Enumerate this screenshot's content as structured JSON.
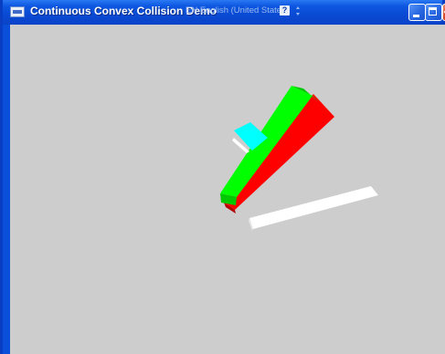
{
  "window": {
    "title": "Continuous Convex Collision Demo",
    "language_indicator": "EN English (United States)",
    "help_glyph": "?",
    "controls": [
      "minimize",
      "maximize",
      "close"
    ]
  },
  "viewport": {
    "background_color": "#cdcdcd",
    "objects": [
      {
        "name": "green-box",
        "color": "#00ff00",
        "shade": "#00c800"
      },
      {
        "name": "red-box",
        "color": "#ff0000",
        "shade": "#b40000"
      },
      {
        "name": "cyan-cube",
        "color": "#00ffff",
        "shade": "#00c8c8"
      },
      {
        "name": "white-plank",
        "color": "#ffffff",
        "shade": "#e6e6e6"
      }
    ]
  }
}
